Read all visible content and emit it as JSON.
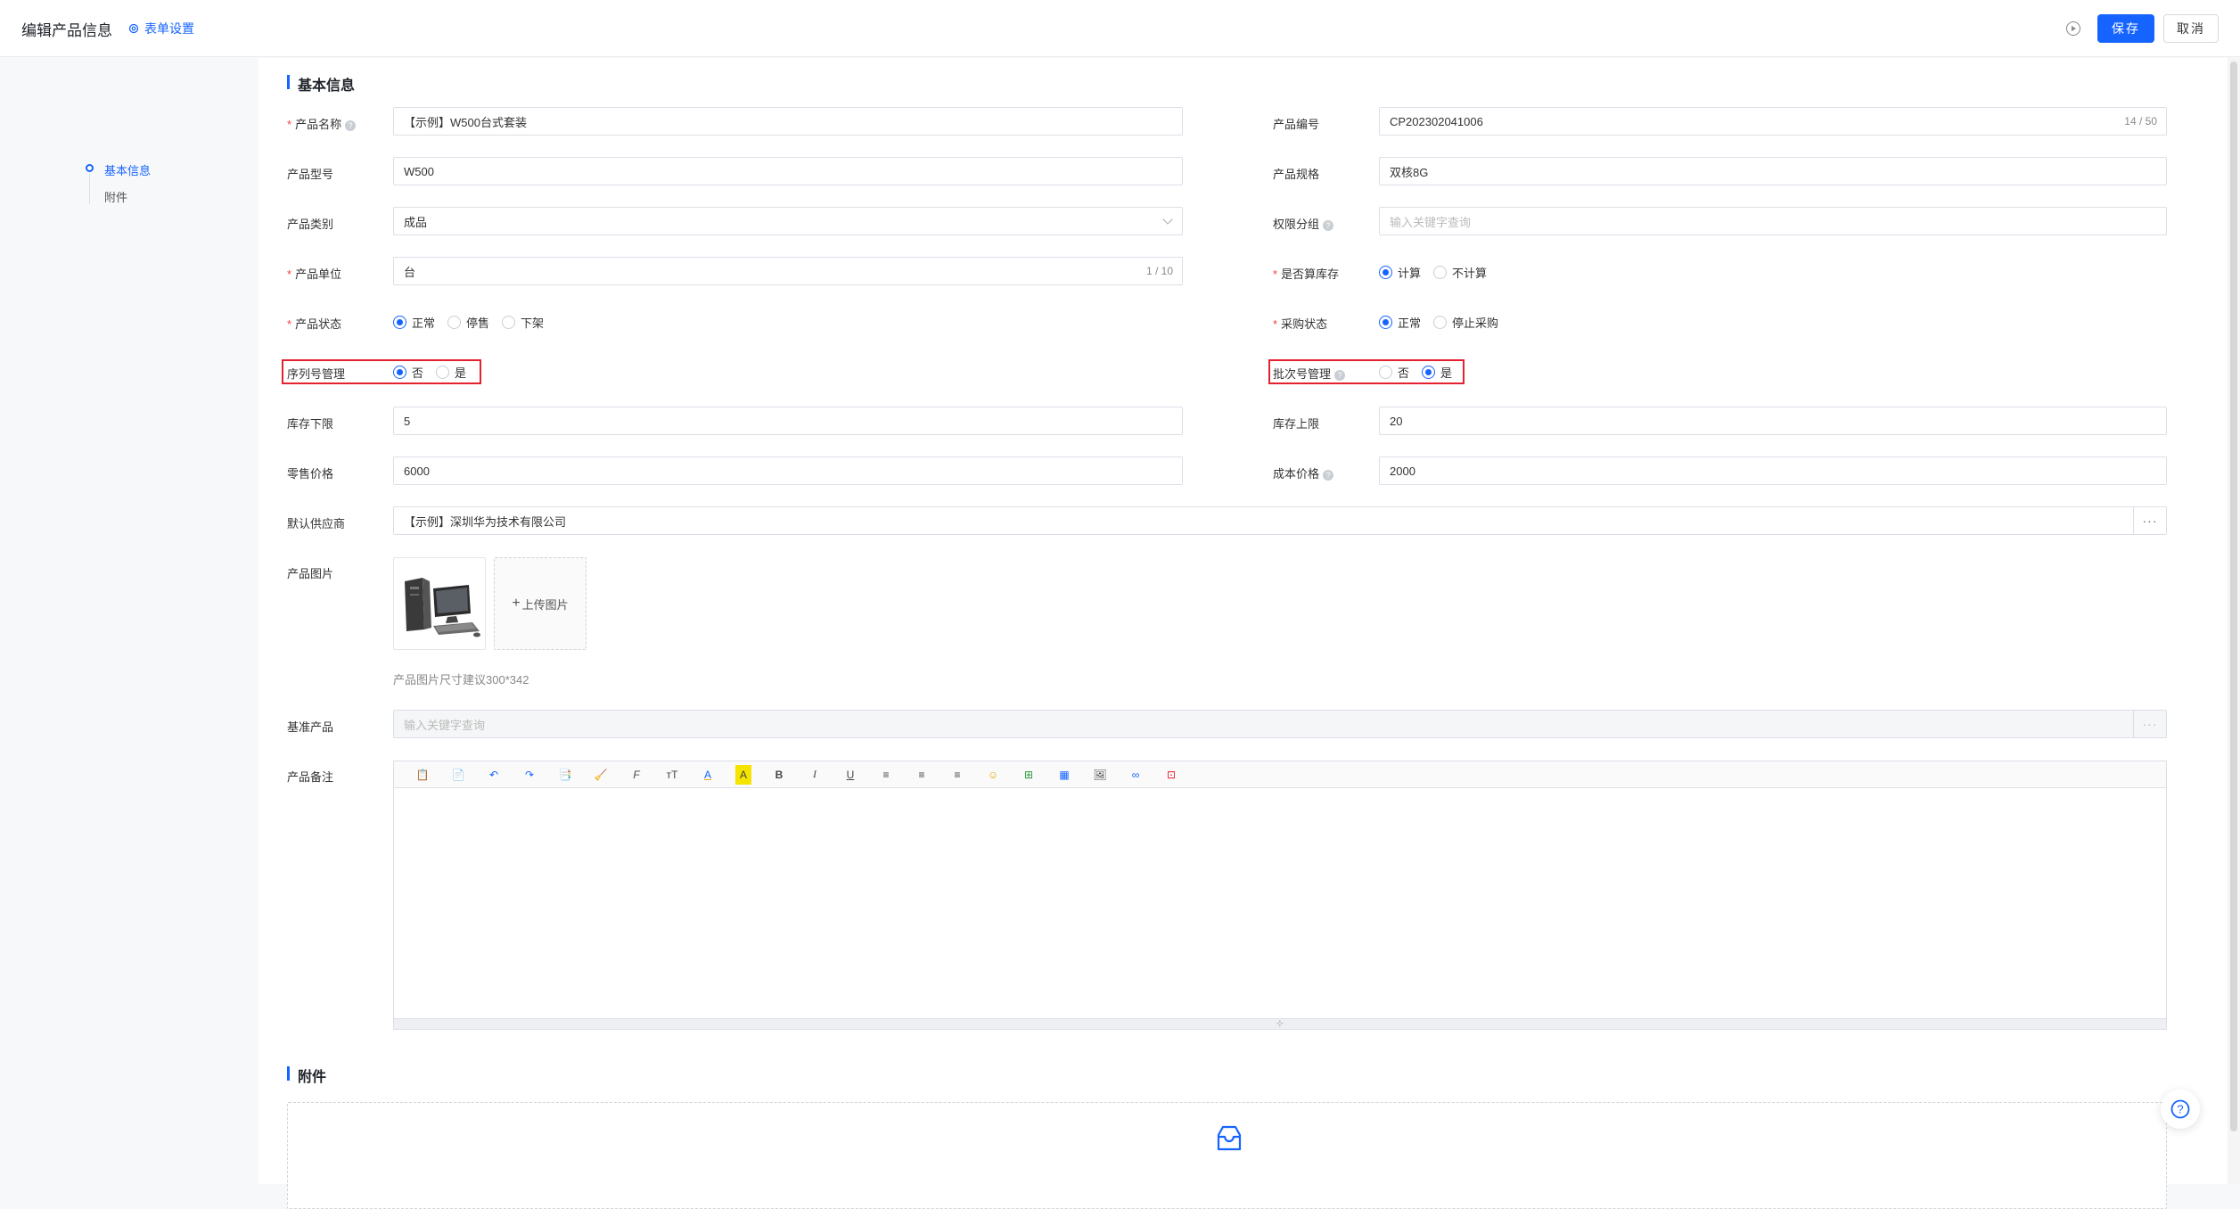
{
  "header": {
    "title": "编辑产品信息",
    "settings_label": "表单设置",
    "save_label": "保存",
    "cancel_label": "取消"
  },
  "sidenav": {
    "items": [
      {
        "label": "基本信息"
      },
      {
        "label": "附件"
      }
    ]
  },
  "sections": {
    "basic": "基本信息",
    "attachments": "附件"
  },
  "form": {
    "product_name": {
      "label": "产品名称",
      "value": "【示例】W500台式套装"
    },
    "product_code": {
      "label": "产品编号",
      "value": "CP202302041006",
      "counter": "14 / 50"
    },
    "model": {
      "label": "产品型号",
      "value": "W500"
    },
    "spec": {
      "label": "产品规格",
      "value": "双核8G"
    },
    "category": {
      "label": "产品类别",
      "value": "成品"
    },
    "permission_group": {
      "label": "权限分组",
      "placeholder": "输入关键字查询"
    },
    "unit": {
      "label": "产品单位",
      "value": "台",
      "counter": "1 / 10"
    },
    "count_stock": {
      "label": "是否算库存",
      "options": [
        "计算",
        "不计算"
      ],
      "selected": "计算"
    },
    "status": {
      "label": "产品状态",
      "options": [
        "正常",
        "停售",
        "下架"
      ],
      "selected": "正常"
    },
    "purchase_status": {
      "label": "采购状态",
      "options": [
        "正常",
        "停止采购"
      ],
      "selected": "正常"
    },
    "serial_mgmt": {
      "label": "序列号管理",
      "options": [
        "否",
        "是"
      ],
      "selected": "否"
    },
    "batch_mgmt": {
      "label": "批次号管理",
      "options": [
        "否",
        "是"
      ],
      "selected": "是"
    },
    "stock_min": {
      "label": "库存下限",
      "value": "5"
    },
    "stock_max": {
      "label": "库存上限",
      "value": "20"
    },
    "retail_price": {
      "label": "零售价格",
      "value": "6000"
    },
    "cost_price": {
      "label": "成本价格",
      "value": "2000"
    },
    "supplier": {
      "label": "默认供应商",
      "value": "【示例】深圳华为技术有限公司",
      "more": "···"
    },
    "image": {
      "label": "产品图片",
      "upload_label": "上传图片",
      "hint": "产品图片尺寸建议300*342"
    },
    "base_product": {
      "label": "基准产品",
      "placeholder": "输入关键字查询",
      "more": "···"
    },
    "remarks": {
      "label": "产品备注"
    }
  },
  "editor_toolbar": [
    "paste-icon",
    "paste-text-icon",
    "undo-icon",
    "redo-icon",
    "copy-format-icon",
    "clear-format-icon",
    "font-family-icon",
    "font-size-icon",
    "font-color-icon",
    "highlight-color-icon",
    "bold-icon",
    "italic-icon",
    "underline-icon",
    "align-left-icon",
    "align-center-icon",
    "align-right-icon",
    "emoji-icon",
    "insert-row-icon",
    "table-icon",
    "image-icon",
    "link-icon",
    "source-code-icon"
  ],
  "toolbar_glyphs": [
    "📋",
    "📄",
    "↶",
    "↷",
    "📑",
    "🧹",
    "F",
    "тT",
    "A",
    "A",
    "B",
    "I",
    "U",
    "≡",
    "≡",
    "≡",
    "☺",
    "⊞",
    "▦",
    "🖼",
    "∞",
    "⊡"
  ],
  "colors": {
    "accent": "#1664ff",
    "highlight_box": "#e5202f",
    "required": "#f53f3f"
  }
}
